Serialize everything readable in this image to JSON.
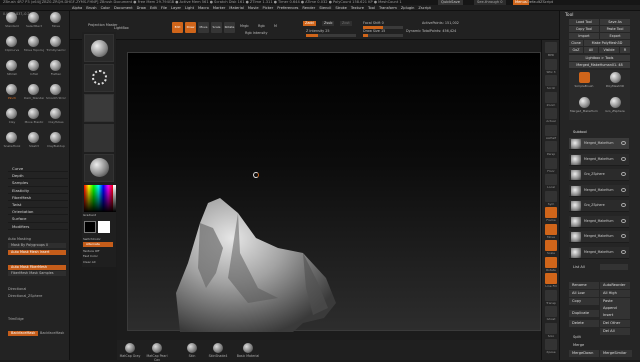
{
  "title_bar": {
    "left": "ZBrush 4R7 P3 (x64)[ZBZ0-ZRQH-DHGF-ZYMS-FHNP]   ZBrush Document   ● Free Mem 29.794GB ● Active Mem 561 ● Scratch Disk 161 ● ZTime 1.311 ● Timer 0.644 ● ATime 0.032 ● PolyCount 158.621 KP ● MeshCount 1",
    "quicksave": "QuickSave",
    "see_through": "See-through 0",
    "menus_label": "Menus",
    "script_label": "DefaultZScript"
  },
  "menubar": [
    "Alpha",
    "Brush",
    "Color",
    "Document",
    "Draw",
    "Edit",
    "File",
    "Layer",
    "Light",
    "Macro",
    "Marker",
    "Material",
    "Movie",
    "Picker",
    "Preferences",
    "Render",
    "Stencil",
    "Stroke",
    "Texture",
    "Tool",
    "Transform",
    "Zplugin",
    "Zscript"
  ],
  "coords": "0.015,0.837,-0.24",
  "left_brushes": [
    {
      "label": "Standard",
      "active": false
    },
    {
      "label": "SelectRect",
      "active": false
    },
    {
      "label": "Move",
      "active": false
    },
    {
      "label": "ClipCurve",
      "active": false
    },
    {
      "label": "Move Topological",
      "active": false
    },
    {
      "label": "TrimDynamic",
      "active": false
    },
    {
      "label": "hPolish",
      "active": false
    },
    {
      "label": "Inflat",
      "active": false
    },
    {
      "label": "Flatten",
      "active": false
    },
    {
      "label": "Pinch",
      "active": true
    },
    {
      "label": "Dam_Standard",
      "active": false
    },
    {
      "label": "Smooth Stronger",
      "active": false
    },
    {
      "label": "Clay",
      "active": false
    },
    {
      "label": "Move Elastic",
      "active": false
    },
    {
      "label": "ClayTubes",
      "active": false
    },
    {
      "label": "SnakeHook",
      "active": false
    },
    {
      "label": "Slash3",
      "active": false
    },
    {
      "label": "ClayBuildup",
      "active": false
    }
  ],
  "left_list": [
    "Curve",
    "Depth",
    "Samples",
    "Elasticity",
    "FiberMesh",
    "Twist",
    "Orientation",
    "Surface",
    "Modifiers"
  ],
  "left_misc": {
    "auto_masking": "Auto Masking",
    "mask_by_polygroups": "Mask By Polygroups 0",
    "mask_bar1": "Auto Mask Mesh Insert",
    "mask_bar2": "Auto Mask FiberMesh",
    "mask_bar3": "FiberMesh Mask Samples",
    "directional": "Directional",
    "directional2": "Directional_ZSphere",
    "tex_label1": "TrimEdge",
    "backface": "BackfaceMask",
    "backface_label": "BackfaceMask"
  },
  "shelf": {
    "projection_master": "Projection Master",
    "lightbox": "LightBox",
    "edit": "Edit",
    "draw": "Draw",
    "move": "Move",
    "scale": "Scale",
    "rotate": "Rotate",
    "mrgb": "Mrgb",
    "rgb": "Rgb",
    "m": "M",
    "rgb_intensity": "Rgb Intensity",
    "zadd": "Zadd",
    "zsub": "Zsub",
    "zcut": "Zcut",
    "focal_shift": "Focal Shift 0",
    "draw_size": "Draw Size 15",
    "z_intensity": "Z Intensity 25",
    "dynamic": "Dynamic",
    "active_points": "ActivePoints: 151,002",
    "total_points": "TotalPoints: 456,424"
  },
  "left_shelf": {
    "gradient": "Gradient",
    "switch_color": "SwitchColor",
    "alternate": "Alternate",
    "texture_off": "Texture Off",
    "fast_color": "Fast Color",
    "clear_all": "Clear All"
  },
  "bottom_shelf": [
    {
      "label": "MatCap Gray"
    },
    {
      "label": "MatCap Pearl Cav"
    },
    {
      "label": "Skin"
    },
    {
      "label": "SkinShade4"
    },
    {
      "label": "Basic Material"
    }
  ],
  "right_shelf": [
    "BPR",
    "SPix 3",
    "Scroll",
    "Zoom",
    "Actual",
    "AAHalf",
    "Persp",
    "Floor",
    "Local",
    "Sym",
    "Frame",
    "Move",
    "Scale",
    "Rotate",
    "Line Fill",
    "Transp",
    "Ghost",
    "Solo",
    "Xpose"
  ],
  "right_tray": {
    "title": "Tool",
    "load_tool": "Load Tool",
    "save_as": "Save As",
    "copy_tool": "Copy Tool",
    "paste_tool": "Paste Tool",
    "import": "Import",
    "export": "Export",
    "clone": "Clone",
    "make_polymesh": "Make PolyMesh3D",
    "goz": "GoZ",
    "all": "All",
    "visible": "Visible",
    "r": "R",
    "lightbox_tools": "Lightbox > Tools",
    "current_tool": "Merged_MakeHuman01. 48",
    "tool_thumbs": [
      "SimpleBrush",
      "PolyMesh3D",
      "Merged_MakeHuman01",
      "Gro_ZSphere"
    ],
    "subtool_header": "Subtool",
    "subtools": [
      "Merged_MakeHum",
      "Merged_MakeHum",
      "Gro_ZSphere",
      "Merged_MakeHum",
      "Gro_ZSphere",
      "Merged_MakeHum",
      "Merged_MakeHum",
      "Merged_MakeHum"
    ],
    "list_all": "List All",
    "rename": "Rename",
    "autoreorder": "AutoReorder",
    "all_low": "All Low",
    "all_high": "All High",
    "copy": "Copy",
    "paste": "Paste",
    "append": "Append",
    "duplicate": "Duplicate",
    "insert": "Insert",
    "delete": "Delete",
    "del_other": "Del Other",
    "del_all": "Del All",
    "split": "Split",
    "merge": "Merge",
    "merge_down": "MergeDown",
    "merge_similar": "MergeSimilar"
  }
}
